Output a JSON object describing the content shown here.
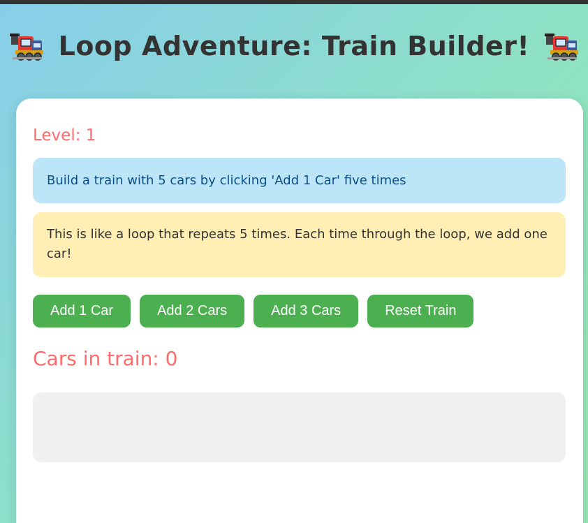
{
  "header": {
    "title": "Loop Adventure: Train Builder!",
    "left_icon": "locomotive-emoji",
    "right_icon": "locomotive-emoji"
  },
  "game": {
    "level_label": "Level: 1",
    "instruction": "Build a train with 5 cars by clicking 'Add 1 Car' five times",
    "hint": "This is like a loop that repeats 5 times. Each time through the loop, we add one car!",
    "count_label": "Cars in train: 0",
    "cars": []
  },
  "buttons": {
    "add1": "Add 1 Car",
    "add2": "Add 2 Cars",
    "add3": "Add 3 Cars",
    "reset": "Reset Train"
  },
  "colors": {
    "accent_red": "#ff6b6b",
    "button_green": "#4caf50",
    "instruction_bg": "#bde5f8",
    "hint_bg": "#ffefb4",
    "train_area_bg": "#f0f0f0"
  }
}
